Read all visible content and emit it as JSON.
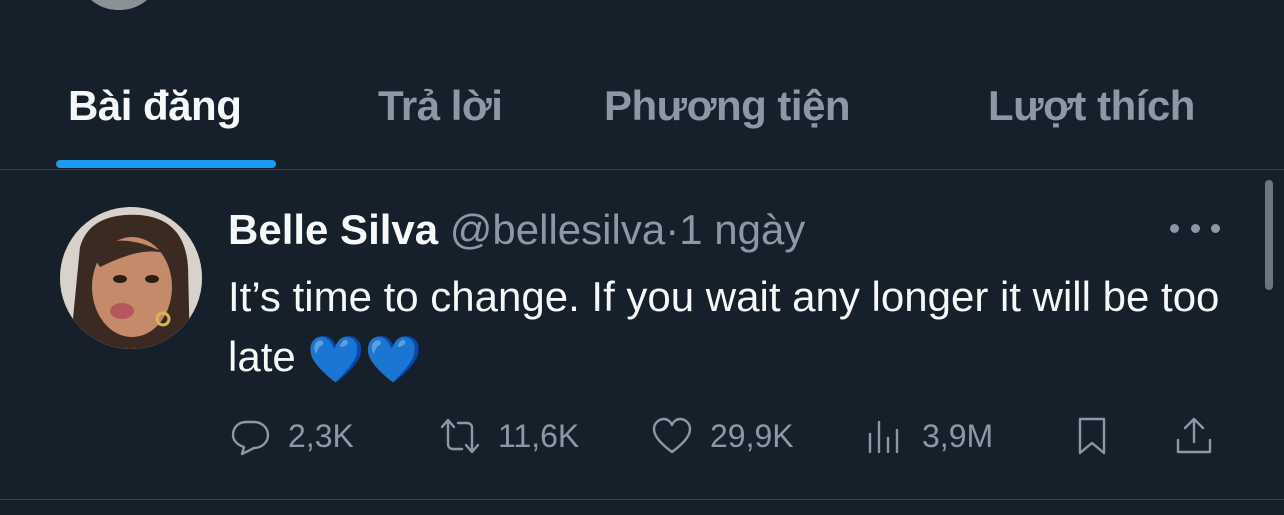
{
  "tabs": [
    {
      "label": "Bài đăng",
      "active": true
    },
    {
      "label": "Trả lời",
      "active": false
    },
    {
      "label": "Phương tiện",
      "active": false
    },
    {
      "label": "Lượt thích",
      "active": false
    }
  ],
  "tweet": {
    "display_name": "Belle Silva",
    "handle": "@bellesilva",
    "separator": "·",
    "time": "1 ngày",
    "text": "It’s time to change. If you wait any longer it will be too late",
    "emoji": "💙💙",
    "stats": {
      "replies": "2,3K",
      "retweets": "11,6K",
      "likes": "29,9K",
      "views": "3,9M"
    }
  },
  "icons": {
    "reply": "reply-icon",
    "retweet": "retweet-icon",
    "like": "heart-icon",
    "views": "views-icon",
    "bookmark": "bookmark-icon",
    "share": "share-icon",
    "more": "more-icon"
  },
  "colors": {
    "background": "#15202b",
    "accent": "#1d9bf0",
    "muted": "#8b98a5",
    "divider": "#38444d"
  }
}
